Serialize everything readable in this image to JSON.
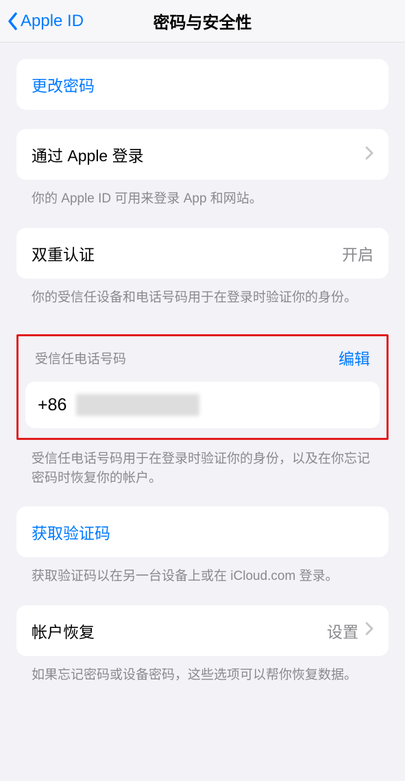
{
  "nav": {
    "back_label": "Apple ID",
    "title": "密码与安全性"
  },
  "change_password": {
    "label": "更改密码"
  },
  "sign_in_apple": {
    "label": "通过 Apple 登录",
    "footer": "你的 Apple ID 可用来登录 App 和网站。"
  },
  "two_factor": {
    "label": "双重认证",
    "value": "开启",
    "footer": "你的受信任设备和电话号码用于在登录时验证你的身份。"
  },
  "trusted_phone": {
    "header": "受信任电话号码",
    "edit": "编辑",
    "number_prefix": "+86",
    "footer": "受信任电话号码用于在登录时验证你的身份，以及在你忘记密码时恢复你的帐户。"
  },
  "get_code": {
    "label": "获取验证码",
    "footer": "获取验证码以在另一台设备上或在 iCloud.com 登录。"
  },
  "account_recovery": {
    "label": "帐户恢复",
    "value": "设置",
    "footer": "如果忘记密码或设备密码，这些选项可以帮你恢复数据。"
  }
}
